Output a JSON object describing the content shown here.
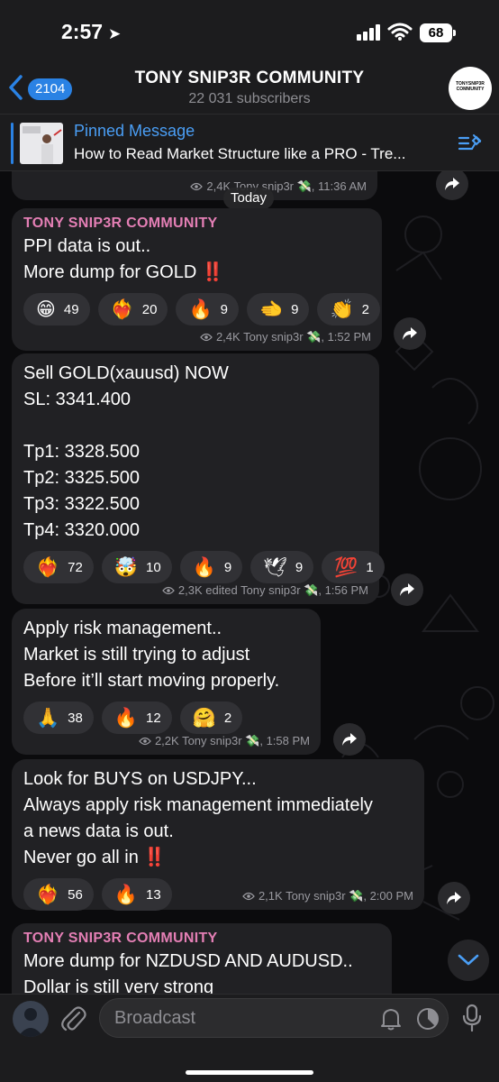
{
  "status_bar": {
    "time": "2:57",
    "battery": "68"
  },
  "header": {
    "back_count": "2104",
    "title": "TONY SNIP3R COMMUNITY",
    "subtitle": "22 031 subscribers",
    "avatar_text": "TONYSNIP3R COMMUNITY"
  },
  "pinned": {
    "label": "Pinned Message",
    "text": "How to Read Market Structure like a PRO - Tre..."
  },
  "top_partial": {
    "meta": "2,4K Tony snip3r 💸, 11:36 AM"
  },
  "date_divider": "Today",
  "messages": [
    {
      "sender": "TONY SNIP3R COMMUNITY",
      "lines": [
        "PPI data is out..",
        "More dump for GOLD ‼️"
      ],
      "reactions": [
        {
          "emoji": "😁",
          "count": "49"
        },
        {
          "emoji": "❤️‍🔥",
          "count": "20"
        },
        {
          "emoji": "🔥",
          "count": "9"
        },
        {
          "emoji": "🫲",
          "count": "9"
        },
        {
          "emoji": "👏",
          "count": "2"
        }
      ],
      "meta": "2,4K Tony snip3r 💸, 1:52 PM"
    },
    {
      "lines": [
        "Sell GOLD(xauusd) NOW",
        "SL: 3341.400",
        "",
        "Tp1: 3328.500",
        "Tp2: 3325.500",
        "Tp3: 3322.500",
        "Tp4: 3320.000"
      ],
      "reactions": [
        {
          "emoji": "❤️‍🔥",
          "count": "72"
        },
        {
          "emoji": "🤯",
          "count": "10"
        },
        {
          "emoji": "🔥",
          "count": "9"
        },
        {
          "emoji": "🕊",
          "count": "9"
        },
        {
          "emoji": "💯",
          "count": "1"
        }
      ],
      "meta": "2,3K edited Tony snip3r 💸, 1:56 PM"
    },
    {
      "lines": [
        "Apply risk management..",
        "Market is still trying to adjust",
        "Before it’ll start moving properly."
      ],
      "reactions": [
        {
          "emoji": "🙏",
          "count": "38"
        },
        {
          "emoji": "🔥",
          "count": "12"
        },
        {
          "emoji": "🤗",
          "count": "2"
        }
      ],
      "meta": "2,2K Tony snip3r 💸, 1:58 PM"
    },
    {
      "lines": [
        "Look for BUYS on USDJPY...",
        "Always apply risk management immediately",
        "a news data is out.",
        "Never go all in ‼️"
      ],
      "reactions": [
        {
          "emoji": "❤️‍🔥",
          "count": "56"
        },
        {
          "emoji": "🔥",
          "count": "13"
        }
      ],
      "meta": "2,1K Tony snip3r 💸, 2:00 PM"
    },
    {
      "sender": "TONY SNIP3R COMMUNITY",
      "lines": [
        "More dump for NZDUSD AND AUDUSD..",
        "Dollar is still very strong"
      ]
    }
  ],
  "input": {
    "placeholder": "Broadcast"
  }
}
